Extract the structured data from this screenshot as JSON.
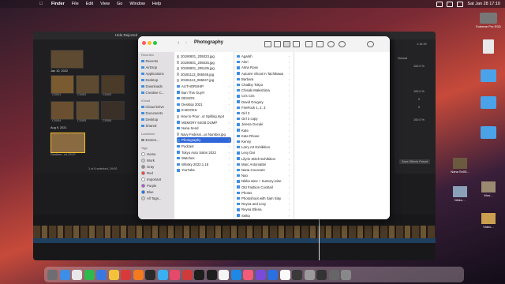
{
  "menubar": {
    "apple": "",
    "app": "Finder",
    "items": [
      "File",
      "Edit",
      "View",
      "Go",
      "Window",
      "Help"
    ],
    "datetime": "Sat Jan 28  17:10"
  },
  "desktop": {
    "items": [
      {
        "label": "Extreme Pro SSD",
        "kind": "drive"
      },
      {
        "label": "",
        "kind": "doc"
      },
      {
        "label": "",
        "kind": "folder"
      },
      {
        "label": "",
        "kind": "folder"
      },
      {
        "label": "",
        "kind": "folder"
      },
      {
        "label": "Nana Sn05...",
        "kind": "thumb"
      },
      {
        "label": "Nikko…",
        "kind": "thumb"
      },
      {
        "label": "Moo...",
        "kind": "thumb"
      },
      {
        "label": "Video...",
        "kind": "thumb"
      }
    ]
  },
  "fcp": {
    "hide_rejected": "Hide Rejected",
    "date1": "Jan 10, 2022",
    "date2": "Aug 9, 2021",
    "clip_codes": [
      "C0001",
      "C0002",
      "C0003",
      "C0004",
      "C0005",
      "C0006"
    ],
    "selected_clip": "Gentlem...ini 29:07",
    "status": "1 of 6 selected, 19:00",
    "inspector_mode": "Normal",
    "inspector_values": [
      "100.0 %",
      "100.0 %",
      "0",
      "0",
      "100.0 %"
    ],
    "save_preset": "Save Effects Preset",
    "timecode_right": "1:16:39"
  },
  "finder": {
    "title": "Photography",
    "sidebar": {
      "favorites_header": "Favorites",
      "favorites": [
        "Recents",
        "AirDrop",
        "Applications",
        "Desktop",
        "Downloads",
        "Creative C..."
      ],
      "icloud_header": "iCloud",
      "icloud": [
        "iCloud Drive",
        "Documents",
        "Desktop",
        "Shared"
      ],
      "locations_header": "Locations",
      "locations": [
        "Extrem..."
      ],
      "tags_header": "Tags",
      "tags": [
        {
          "label": "Home",
          "color": "#ffffff"
        },
        {
          "label": "Work",
          "color": "#cccccc"
        },
        {
          "label": "Gray",
          "color": "#8e8e93"
        },
        {
          "label": "Red",
          "color": "#ff3b30"
        },
        {
          "label": "Important",
          "color": "#ffffff"
        },
        {
          "label": "Purple",
          "color": "#af52de"
        },
        {
          "label": "Blue",
          "color": "#007aff"
        },
        {
          "label": "All Tags...",
          "color": "#cfcfcf"
        }
      ]
    },
    "col1": [
      "20190801_205023.jpg",
      "20190801_205026.jpg",
      "20190801_205105.jpg",
      "20181113_065046.jpg",
      "20181113_065047.jpg",
      "AUTHORSHIP",
      "Ban This Guy!!!",
      "DESIGN",
      "Desktop 2021",
      "E-BOOKS",
      "How to Pour...ut Spilling.mp4",
      "MEMORY 64GB DUMP",
      "Nana Send",
      "Navy Federal...us Number.jpg",
      "Photography",
      "Podcast",
      "Tokyo Auto Salon 2022",
      "Watches",
      "Whisky 2022.1.18",
      "YouTube"
    ],
    "col1_selected": 14,
    "col2": [
      "Agarkh",
      "Aleri",
      "Alma Rose",
      "Autumn Shoot in Tachikawa",
      "Barbara",
      "Chabby Tokyo",
      "Chisaki Makishima",
      "Cris Cris",
      "David Gregory",
      "FireRock 1, 2, 3",
      "Girl 3",
      "Girl 3 copy",
      "Jelena Gucuki",
      "Kate",
      "Kate Rhose",
      "Kenny",
      "Larry Art Exhibition",
      "Lexy Dar",
      "Lilyrin Stitch Exhibition",
      "Marc Antomattei",
      "Nana Coconuts",
      "Nao",
      "Nikka wine + Suntory wine",
      "Old Fashion Cocktail",
      "Photos",
      "Photoshoot with Sam Slay",
      "Reyna and Lexy",
      "Reyna Ellena",
      "Seika"
    ]
  },
  "dock": {
    "colors": [
      "#6d6d72",
      "#3d8ee6",
      "#e8e8e8",
      "#2fb84c",
      "#3a78e0",
      "#f4c23a",
      "#d83a3a",
      "#f27a1f",
      "#2a2a2a",
      "#3bb0f0",
      "#e64a6a",
      "#cf3b3b",
      "#1e1e1e",
      "#1e1e1e",
      "#f5f5f5",
      "#1e88e5",
      "#f25c78",
      "#7a4ad8",
      "#2b6fe0",
      "#fafafa",
      "#3a3a3a",
      "#9a9a9a",
      "#333",
      "#666",
      "#888"
    ]
  }
}
